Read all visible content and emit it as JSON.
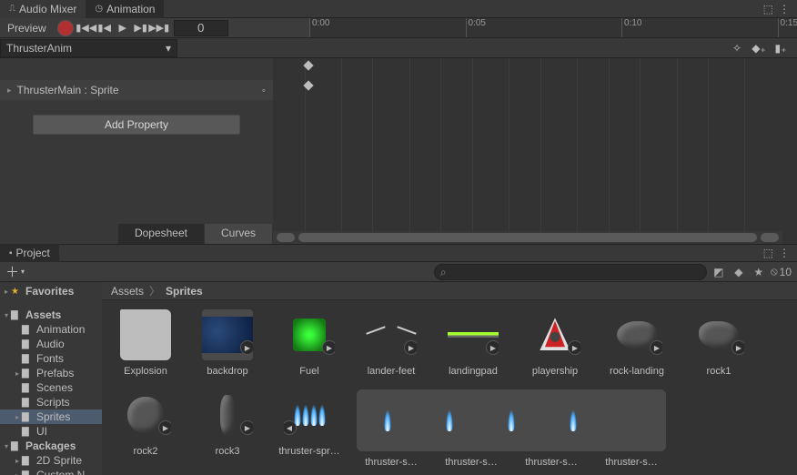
{
  "tabs": {
    "audio_mixer": "Audio Mixer",
    "animation": "Animation"
  },
  "anim": {
    "preview": "Preview",
    "frame": "0",
    "clip": "ThrusterAnim",
    "track": "ThrusterMain : Sprite",
    "add_property": "Add Property",
    "dopesheet": "Dopesheet",
    "curves": "Curves",
    "ticks": [
      "0:00",
      "0:05",
      "0:10",
      "0:15"
    ]
  },
  "project": {
    "tab": "Project",
    "visible_count": "10",
    "breadcrumb": [
      "Assets",
      "Sprites"
    ],
    "tree": {
      "favorites": "Favorites",
      "assets": "Assets",
      "animation_f": "Animation",
      "audio": "Audio",
      "fonts": "Fonts",
      "prefabs": "Prefabs",
      "scenes": "Scenes",
      "scripts": "Scripts",
      "sprites": "Sprites",
      "ui": "UI",
      "packages": "Packages",
      "sprite2d": "2D Sprite",
      "custom": "Custom N"
    },
    "assets": {
      "explosion": "Explosion",
      "backdrop": "backdrop",
      "fuel": "Fuel",
      "lander_feet": "lander-feet",
      "landingpad": "landingpad",
      "playership": "playership",
      "rock_landing": "rock-landing",
      "rock1": "rock1",
      "rock2": "rock2",
      "rock3": "rock3",
      "thruster_spr": "thruster-spr…",
      "thruster_s1": "thruster-s…",
      "thruster_s2": "thruster-s…",
      "thruster_s3": "thruster-s…",
      "thruster_s4": "thruster-s…"
    }
  }
}
